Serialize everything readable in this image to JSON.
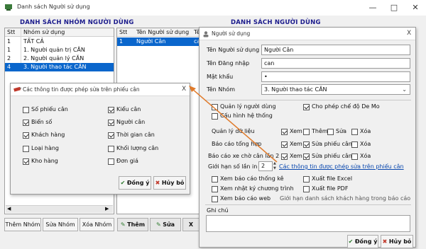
{
  "main_window": {
    "title": "Danh sách Người sử dụng"
  },
  "left_panel": {
    "title": "DANH SÁCH NHÓM NGƯỜI DÙNG",
    "columns": [
      "Stt",
      "Nhóm sử dụng"
    ],
    "rows": [
      {
        "stt": "1",
        "name": "TẤT CẢ"
      },
      {
        "stt": "1",
        "name": "1. Người quản trị CĂN"
      },
      {
        "stt": "2",
        "name": "2. Người quản lý CĂN"
      },
      {
        "stt": "4",
        "name": "3. Người thao tác CĂN"
      }
    ],
    "selected_index": 3,
    "buttons": {
      "add": "Thêm Nhóm",
      "edit": "Sửa Nhóm",
      "delete": "Xóa Nhóm"
    }
  },
  "right_panel": {
    "title": "DANH SÁCH NGƯỜI DÙNG",
    "columns": [
      "Stt",
      "Tên Người sử dụng",
      "Tên"
    ],
    "rows": [
      {
        "stt": "1",
        "name": "Người Cân",
        "login": "cai"
      }
    ],
    "buttons": {
      "add": "Thêm",
      "edit": "Sửa",
      "close": "X"
    }
  },
  "info_dialog": {
    "title": "Các thông tin được phép sửa trên phiếu cân",
    "close": "X",
    "items": [
      {
        "label": "Số phiếu cân",
        "checked": false
      },
      {
        "label": "Kiểu cân",
        "checked": true
      },
      {
        "label": "Biển số",
        "checked": true
      },
      {
        "label": "Người cân",
        "checked": true
      },
      {
        "label": "Khách hàng",
        "checked": true
      },
      {
        "label": "Thời gian cân",
        "checked": true
      },
      {
        "label": "Loại hàng",
        "checked": false
      },
      {
        "label": "Khối lượng cân",
        "checked": false
      },
      {
        "label": "Kho hàng",
        "checked": true
      },
      {
        "label": "Đơn giá",
        "checked": false
      }
    ],
    "ok_label": "Đồng ý",
    "cancel_label": "Hủy bỏ"
  },
  "user_dialog": {
    "title": "Người sử dụng",
    "close": "X",
    "fields": {
      "fullname_label": "Tên Người sử dụng",
      "fullname_value": "Người Cân",
      "login_label": "Tên Đăng nhập",
      "login_value": "can",
      "password_label": "Mật khẩu",
      "password_value": "•",
      "group_label": "Tên Nhóm",
      "group_value": "3. Người thao tác CĂN"
    },
    "perm_user_mgmt": "Quản lý người dùng",
    "perm_demo": "Cho phép chế độ De Mo",
    "perm_config": "Cấu hình hệ thống",
    "data_mgmt": {
      "label": "Quản lý dữ liệu",
      "view": "Xem",
      "add": "Thêm",
      "edit": "Sửa",
      "delete": "Xóa",
      "view_checked": true,
      "add_checked": false,
      "edit_checked": false,
      "delete_checked": false
    },
    "report_total": {
      "label": "Báo cáo tổng hợp",
      "view": "Xem",
      "edit": "Sửa phiếu cân",
      "delete": "Xóa",
      "view_checked": true,
      "edit_checked": true,
      "delete_checked": false
    },
    "report_pending": {
      "label": "Báo cáo xe chờ cân lần 2",
      "view": "Xem",
      "edit": "Sửa phiếu cân",
      "delete": "Xóa",
      "view_checked": true,
      "edit_checked": true,
      "delete_checked": false
    },
    "limit_label": "Giới hạn số lần in",
    "limit_value": "2",
    "info_link": "Các thông tin được phép sửa trên phiếu cân",
    "extra": [
      {
        "label": "Xem báo cáo thống kê",
        "checked": false
      },
      {
        "label": "Xuất file Excel",
        "checked": false
      },
      {
        "label": "Xem nhật ký chương trình",
        "checked": false
      },
      {
        "label": "Xuất file PDF",
        "checked": false
      },
      {
        "label": "Xem báo cáo web",
        "checked": false
      }
    ],
    "customer_limit": "Giới hạn danh sách khách hàng trong báo cáo",
    "note_label": "Ghi chú",
    "ok_label": "Đồng ý",
    "cancel_label": "Hủy bỏ"
  },
  "colors": {
    "section_title": "#1a1a8c",
    "selection": "#0a66cc",
    "arrow": "#e07a2a",
    "link": "#0645ad"
  }
}
